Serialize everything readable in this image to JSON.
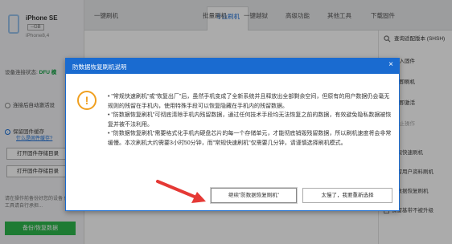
{
  "tabs": [
    "一键刷机",
    "专业刷机",
    "批量刷机",
    "一键越狱",
    "高级功能",
    "其他工具",
    "下载固件"
  ],
  "active_tab_index": 1,
  "device": {
    "name": "iPhone SE",
    "capacity": "--GB",
    "model": "iPhone8,4"
  },
  "left_panel": {
    "connection_label": "设备连接状态:",
    "connection_value": "DFU 模",
    "option1": "连接后自动激活设",
    "option2": "保留固件缓存",
    "option2_link": "什么是固件缓存?",
    "btn_open_cache": "打开固件存储目录",
    "btn_open_storage": "打开固件存储目录",
    "note": "请在操作前备份好您的设备 使用本工具请自行承担...",
    "backup_button": "备份/恢复数据"
  },
  "right_panel": {
    "items": [
      "查询适配版本 (SHSH)",
      "导入固件",
      "立即刷机",
      "立即激活",
      "停止操作"
    ],
    "checks": [
      "常规快速刷机",
      "保留用户资料刷机",
      "防数据恢复刷机",
      "保留基带不被升级"
    ],
    "checked_index": 2,
    "accent": "#1a6bd0"
  },
  "dialog": {
    "title": "防数据恢复刷机说明",
    "close_label": "×",
    "paragraphs": [
      "\"常规快速刷机\"或\"恢复出厂\"后，虽然手机变成了全新系统并且释放出全部剩余空间，但原有的用户数据仍会毫无规则的残留在手机内，使用特殊手段可以恢复隐藏在手机内的残留数据。",
      "\"防数据恢复刷机\"可彻底清除手机内残留数据，通过任何技术手段均无法恢复之前的数据，有效避免隐私数据被恢复并被不法利用。",
      "\"防数据恢复刷机\"需要格式化手机内硬盘芯片的每一个存储单元，才能彻底销毁残留数据，所以刷机速度将会非常缓慢。本次刷机大约需要3小时50分钟，而\"常规快速刷机\"仅需要几分钟，请谨慎选择刷机模式。"
    ],
    "continue_button": "继续\"防数据恢复刷机\"",
    "cancel_button": "太慢了，我要重新选择"
  },
  "colors": {
    "primary": "#1a6bd0",
    "warning": "#f0a020",
    "success": "#2db84d",
    "arrow": "#e53935"
  }
}
